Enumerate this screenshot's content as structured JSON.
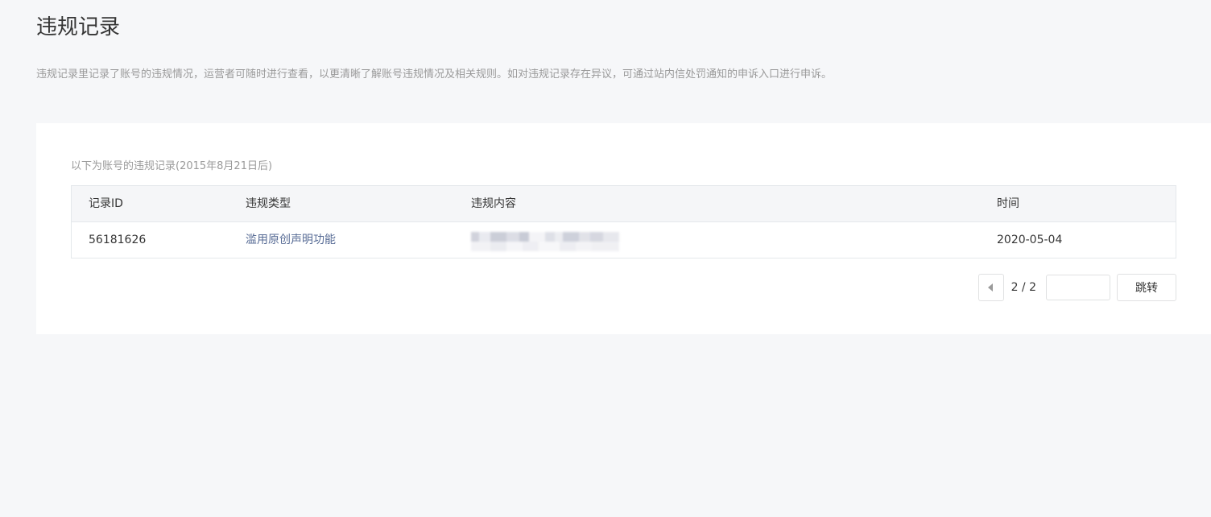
{
  "header": {
    "title": "违规记录",
    "description": "违规记录里记录了账号的违规情况，运营者可随时进行查看，以更清晰了解账号违规情况及相关规则。如对违规记录存在异议，可通过站内信处罚通知的申诉入口进行申诉。"
  },
  "records": {
    "caption": "以下为账号的违规记录(2015年8月21日后)",
    "columns": [
      "记录ID",
      "违规类型",
      "违规内容",
      "时间"
    ],
    "rows": [
      {
        "id": "56181626",
        "type": "滥用原创声明功能",
        "content": "",
        "time": "2020-05-04"
      }
    ]
  },
  "pagination": {
    "page_indicator": "2 / 2",
    "jump_input_value": "",
    "jump_label": "跳转"
  },
  "colors": {
    "link": "#576b95",
    "page_background": "#f6f7f9",
    "muted_text": "#9a9a9a"
  },
  "icons": {
    "prev_page": "caret-left-icon"
  }
}
